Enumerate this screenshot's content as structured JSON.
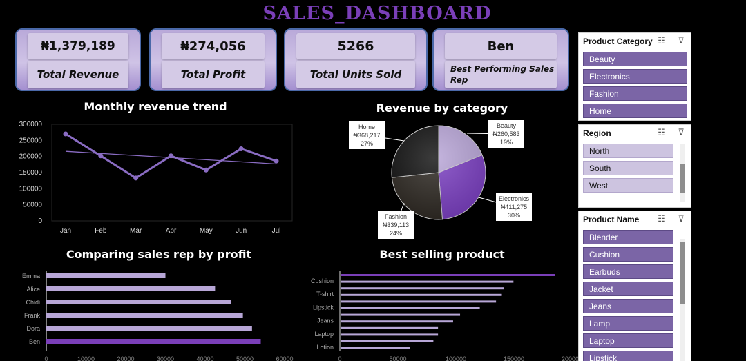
{
  "dashboard": {
    "title": "SALES_DASHBOARD"
  },
  "kpis": [
    {
      "value": "₦1,379,189",
      "label": "Total Revenue"
    },
    {
      "value": "₦274,056",
      "label": "Total Profit"
    },
    {
      "value": "5266",
      "label": "Total Units Sold"
    },
    {
      "value": "Ben",
      "label": "Best Performing Sales Rep"
    }
  ],
  "colors": {
    "accent": "#7a3fb8",
    "bar_light": "#b7a6d6",
    "bar_dark": "#7a3fb8",
    "line": "#8a6cc3"
  },
  "chart_data": [
    {
      "type": "line",
      "title": "Monthly revenue trend",
      "categories": [
        "Jan",
        "Feb",
        "Mar",
        "Apr",
        "May",
        "Jun",
        "Jul"
      ],
      "series": [
        {
          "values": [
            270000,
            202000,
            133000,
            202000,
            158000,
            224000,
            186000
          ]
        }
      ],
      "trendline": true,
      "ylim": [
        0,
        300000
      ],
      "yticks": [
        "300000",
        "250000",
        "200000",
        "150000",
        "100000",
        "50000",
        "0"
      ]
    },
    {
      "type": "pie",
      "title": "Revenue by category",
      "slices": [
        {
          "name": "Beauty",
          "value": "₦260,583",
          "amount": 260583,
          "percent": "19%",
          "color": "#b9a6d8"
        },
        {
          "name": "Electronics",
          "value": "₦411,275",
          "amount": 411275,
          "percent": "30%",
          "color": "#7b3fc2"
        },
        {
          "name": "Fashion",
          "value": "₦339,113",
          "amount": 339113,
          "percent": "24%",
          "color": "#2d2822"
        },
        {
          "name": "Home",
          "value": "₦368,217",
          "amount": 368217,
          "percent": "27%",
          "color": "#111111"
        }
      ]
    },
    {
      "type": "bar",
      "orientation": "horizontal",
      "title": "Comparing sales rep by profit",
      "categories": [
        "Emma",
        "Alice",
        "Chidi",
        "Frank",
        "Dora",
        "Ben"
      ],
      "values": [
        30000,
        42500,
        46500,
        49500,
        51800,
        54000
      ],
      "highlight": "Ben",
      "xlim": [
        0,
        60000
      ],
      "xticks": [
        "0",
        "10000",
        "20000",
        "30000",
        "40000",
        "50000",
        "60000"
      ]
    },
    {
      "type": "bar",
      "orientation": "horizontal",
      "title": "Best selling product",
      "categories": [
        "Cushion",
        "",
        "T-shirt",
        "",
        "Lipstick",
        "",
        "Jeans",
        "",
        "Laptop",
        "",
        "Lotion"
      ],
      "values": [
        185000,
        149000,
        141000,
        139000,
        134000,
        120000,
        103000,
        97000,
        84000,
        84000,
        80000,
        60000
      ],
      "xlim": [
        0,
        200000
      ],
      "xticks": [
        "0",
        "50000",
        "100000",
        "150000",
        "200000"
      ]
    }
  ],
  "slicers": {
    "category": {
      "title": "Product Category",
      "items": [
        "Beauty",
        "Electronics",
        "Fashion",
        "Home"
      ]
    },
    "region": {
      "title": "Region",
      "items": [
        "North",
        "South",
        "West"
      ]
    },
    "product": {
      "title": "Product Name",
      "items": [
        "Blender",
        "Cushion",
        "Earbuds",
        "Jacket",
        "Jeans",
        "Lamp",
        "Laptop",
        "Lipstick"
      ]
    },
    "icons": {
      "multiselect": "multi-select-icon",
      "clear": "clear-filter-icon"
    }
  }
}
